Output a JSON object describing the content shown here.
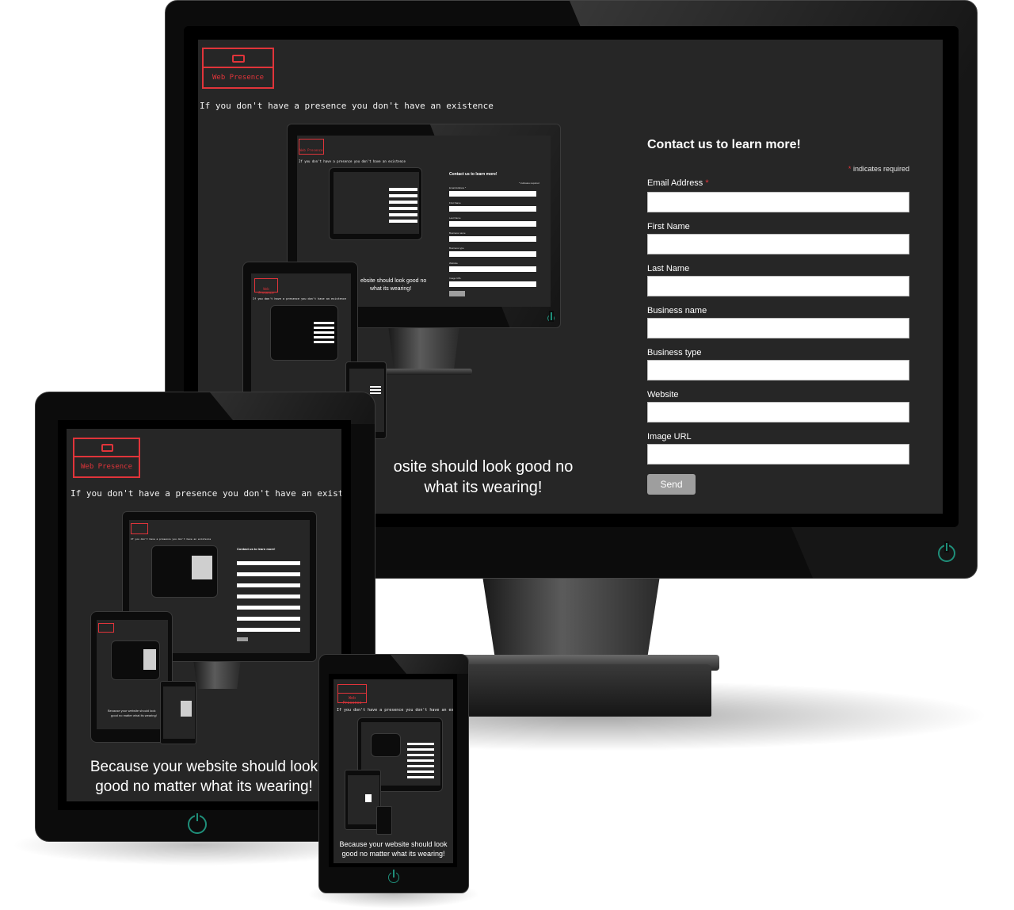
{
  "site": {
    "logo_text": "Web Presence",
    "tagline": "If you don't have a presence you don't have an existence",
    "caption": "Because your website should look good no matter what its wearing!",
    "caption_line1": "Because your website should look",
    "caption_line2": "good no matter what its wearing!",
    "caption_desktop_line1": "osite should look good no",
    "caption_desktop_line2": "what its wearing!"
  },
  "form": {
    "heading": "Contact us to learn more!",
    "required_star": "*",
    "required_note": "indicates required",
    "fields": [
      {
        "label": "Email Address",
        "required": true,
        "value": ""
      },
      {
        "label": "First Name",
        "required": false,
        "value": ""
      },
      {
        "label": "Last Name",
        "required": false,
        "value": ""
      },
      {
        "label": "Business name",
        "required": false,
        "value": ""
      },
      {
        "label": "Business type",
        "required": false,
        "value": ""
      },
      {
        "label": "Website",
        "required": false,
        "value": ""
      },
      {
        "label": "Image URL",
        "required": false,
        "value": ""
      }
    ],
    "submit_label": "Send"
  },
  "mini": {
    "form_heading": "Contact us to learn more!",
    "required_note": "* indicates required",
    "labels": [
      "Email Address *",
      "First Name",
      "Last Name",
      "Business name",
      "Business type",
      "Website",
      "Image URL"
    ],
    "send": "Send",
    "caption_line1": "Because your website should look",
    "caption_line2": "good no matter what its wearing!",
    "caption_cut_line1": "ebsite should look good no",
    "caption_cut_line2": "what its wearing!",
    "caption_tiny_line1": "Because your website should look",
    "caption_tiny_line2": "good no matter what its wearing!"
  },
  "colors": {
    "screen_bg": "#262626",
    "brand_red": "#e0343a",
    "bezel": "#0c0c0c",
    "power_teal": "#1f8f7a",
    "button_gray": "#9e9e9e"
  },
  "icons": [
    "power-icon",
    "logo-icon"
  ]
}
